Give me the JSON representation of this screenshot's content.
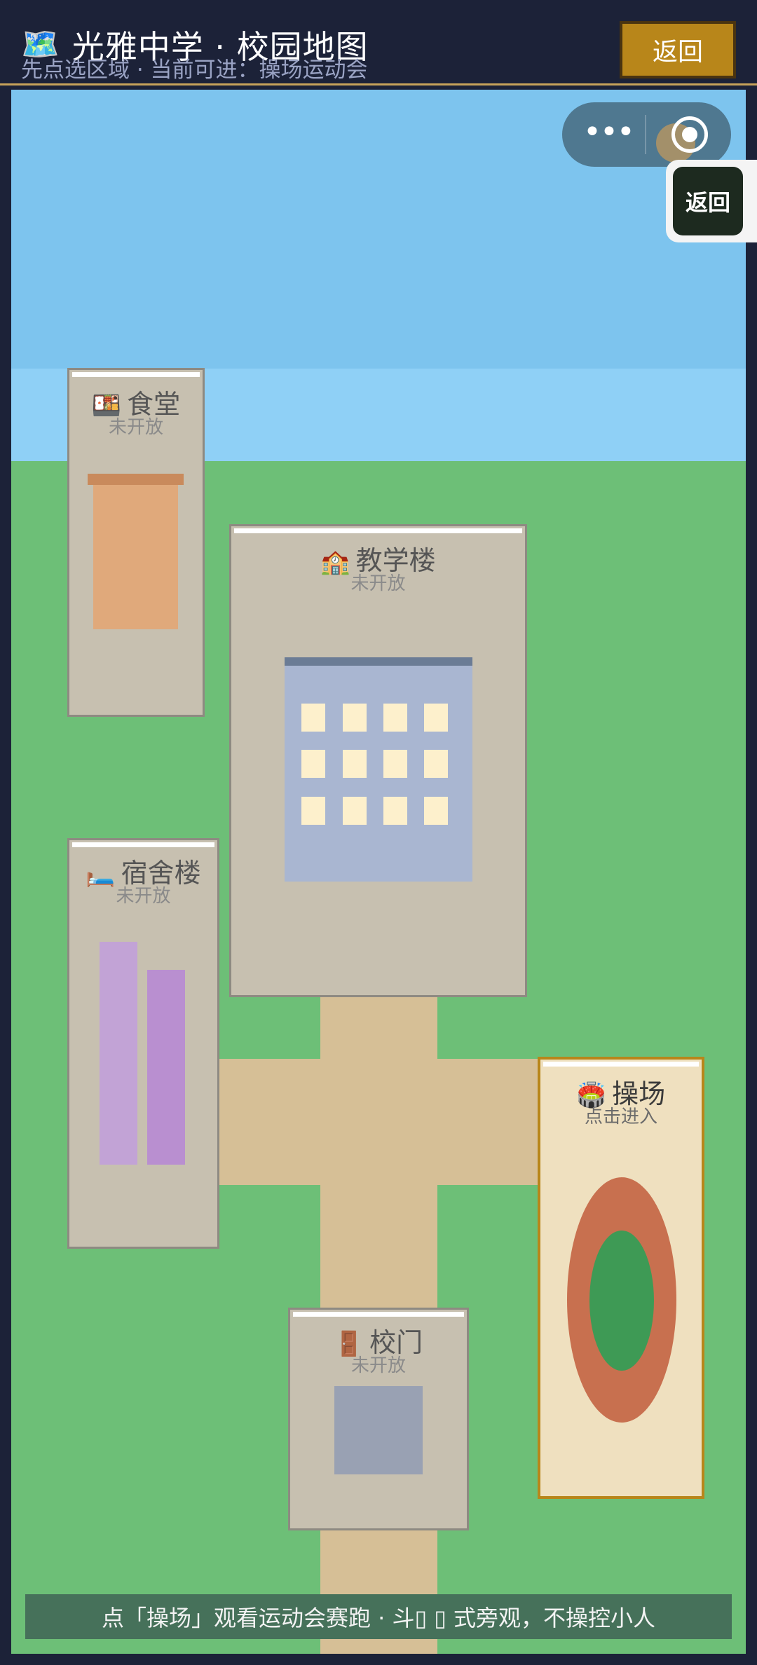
{
  "header": {
    "title_emoji": "🗺️",
    "title": "光雅中学 · 校园地图",
    "subtitle": "先点选区域 · 当前可进：操场运动会",
    "back_label": "返回"
  },
  "overlay": {
    "capsule_more": "•••",
    "float_back_label": "返回"
  },
  "buildings": {
    "canteen": {
      "emoji": "🍱",
      "name": "食堂",
      "status": "未开放"
    },
    "teaching": {
      "emoji": "🏫",
      "name": "教学楼",
      "status": "未开放"
    },
    "dorm": {
      "emoji": "🛏️",
      "name": "宿舍楼",
      "status": "未开放"
    },
    "playground": {
      "emoji": "🏟️",
      "name": "操场",
      "status": "点击进入"
    },
    "gate": {
      "emoji": "🚪",
      "name": "校门",
      "status": "未开放"
    }
  },
  "footer": {
    "hint": "点「操场」观看运动会赛跑 · 斗▯ ▯ 式旁观，不操控小人"
  },
  "colors": {
    "header_bg": "#1c2238",
    "back_button": "#b8861a",
    "grass": "#6dbf77",
    "sky": "#7dc4ee",
    "path": "#d6bf96",
    "track": "#c8704f",
    "field": "#3e9a55",
    "playground_bg": "#efe0bf"
  }
}
